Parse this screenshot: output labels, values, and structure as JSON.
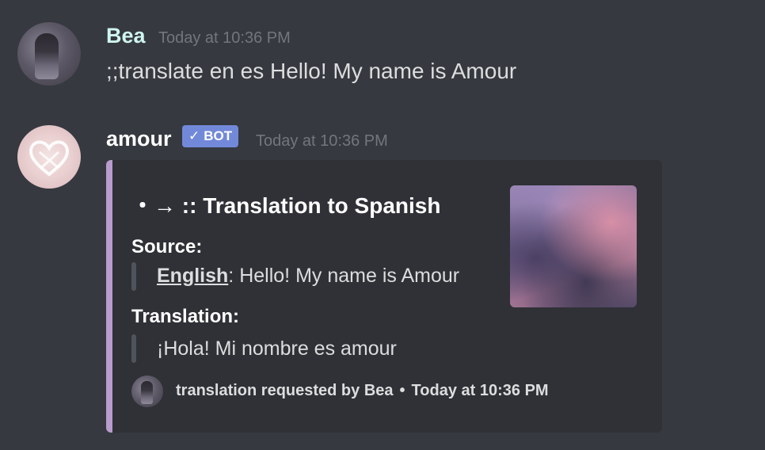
{
  "messages": [
    {
      "username": "Bea",
      "username_color": "#cff5ef",
      "timestamp": "Today at 10:36 PM",
      "content": ";;translate en es Hello! My name is Amour"
    },
    {
      "username": "amour",
      "username_color": "#ffffff",
      "badge": "BOT",
      "timestamp": "Today at 10:36 PM",
      "embed": {
        "accent_color": "#b89ccc",
        "title": "・→ :: Translation to Spanish",
        "fields": [
          {
            "name": "Source:",
            "language": "English",
            "separator": ": ",
            "value": "Hello! My name is Amour"
          },
          {
            "name": "Translation:",
            "value": "¡Hola! Mi nombre es amour"
          }
        ],
        "footer": {
          "text": "translation requested by Bea",
          "separator": "•",
          "timestamp": "Today at 10:36 PM"
        }
      }
    }
  ]
}
